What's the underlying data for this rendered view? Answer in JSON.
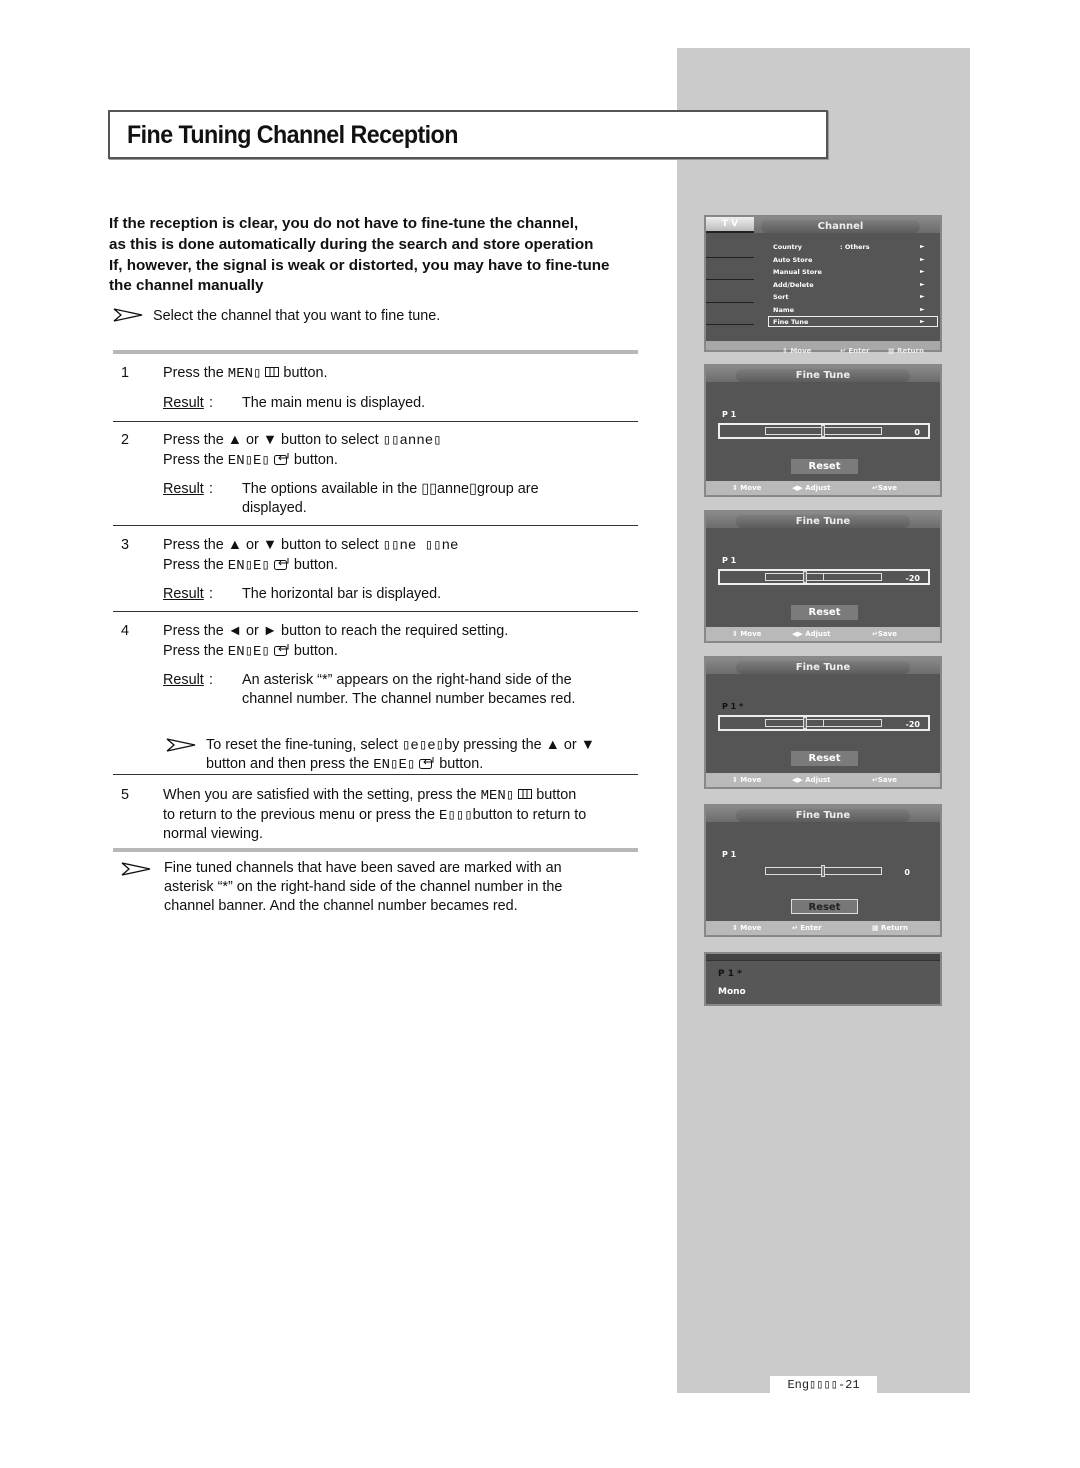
{
  "title": "Fine Tuning Channel Reception",
  "intro_lines": [
    "If the reception is clear, you do not have to fine-tune the channel,",
    "as this is done automatically during the search and store operation",
    "If, however, the signal is weak or distorted, you may have to fine-tune",
    "the channel manually"
  ],
  "intro_note": "Select the channel that you want to fine tune.",
  "result_label": "Result",
  "steps": [
    {
      "num": "1",
      "lines": [
        {
          "pre": "Press the ",
          "key": "MEN▯",
          "icon": "menu-icon",
          "post": " button."
        }
      ],
      "result": "The main menu is displayed."
    },
    {
      "num": "2",
      "lines": [
        {
          "pre": "Press the ▲ or ▼ button to select ",
          "key": "▯▯anne▯",
          "post": ""
        },
        {
          "pre": "Press the ",
          "key": "EN▯E▯",
          "icon": "enter-icon",
          "post": " button."
        }
      ],
      "result": "The options available in the ▯▯anne▯group are displayed."
    },
    {
      "num": "3",
      "lines": [
        {
          "pre": "Press the ▲ or ▼ button to select ",
          "key": "▯▯ne ▯▯ne",
          "post": ""
        },
        {
          "pre": "Press the ",
          "key": "EN▯E▯",
          "icon": "enter-icon",
          "post": " button."
        }
      ],
      "result": "The horizontal bar is displayed."
    },
    {
      "num": "4",
      "lines": [
        {
          "pre": "Press the ◄ or ► button to reach the required setting.",
          "key": "",
          "post": ""
        },
        {
          "pre": "Press the ",
          "key": "EN▯E▯",
          "icon": "enter-icon",
          "post": " button."
        }
      ],
      "result_lines": [
        "An asterisk  “*” appears on the right-hand side of the",
        "channel number. The channel number becames red."
      ],
      "note_lines": [
        {
          "pre": "To reset the fine-tuning, select ",
          "key": "▯e▯e▯",
          "post": "by pressing the ▲ or ▼"
        },
        {
          "pre": "button and then press the ",
          "key": "EN▯E▯",
          "icon": "enter-icon",
          "post": " button."
        }
      ]
    },
    {
      "num": "5",
      "lines": [
        {
          "pre": "When you are satisfied with the setting, press the ",
          "key": "MEN▯",
          "icon": "menu-icon",
          "post": " button"
        },
        {
          "pre": "to return to the previous menu or press the ",
          "key": "E▯▯▯",
          "post": "button to return to"
        },
        {
          "pre": "normal viewing.",
          "key": "",
          "post": ""
        }
      ]
    }
  ],
  "final_note_lines": [
    "Fine tuned channels that have been saved are marked with an",
    "asterisk “*” on the right-hand side of the channel number in the",
    "channel banner. And the channel number becames red."
  ],
  "tv_channel_menu": {
    "tab": "T V",
    "header": "Channel",
    "items": [
      {
        "label": "Country",
        "value": ":  Others"
      },
      {
        "label": "Auto Store",
        "value": ""
      },
      {
        "label": "Manual Store",
        "value": ""
      },
      {
        "label": "Add/Delete",
        "value": ""
      },
      {
        "label": "Sort",
        "value": ""
      },
      {
        "label": "Name",
        "value": ""
      },
      {
        "label": "Fine Tune",
        "value": ""
      }
    ],
    "selected_index": 6,
    "footer": {
      "move": "Move",
      "enter": "Enter",
      "return": "Return"
    }
  },
  "fine_tune_screens": [
    {
      "header": "Fine Tune",
      "channel": "P  1",
      "value_label": "0",
      "value": 0,
      "adjusted": false,
      "reset": "Reset",
      "reset_selected": false,
      "footer": {
        "move": "Move",
        "mid": "Adjust",
        "right": "Save"
      }
    },
    {
      "header": "Fine Tune",
      "channel": "P  1",
      "value_label": "-20",
      "value": -20,
      "adjusted": false,
      "reset": "Reset",
      "reset_selected": false,
      "footer": {
        "move": "Move",
        "mid": "Adjust",
        "right": "Save"
      }
    },
    {
      "header": "Fine Tune",
      "channel": "P  1  *",
      "value_label": "-20",
      "value": -20,
      "adjusted": true,
      "reset": "Reset",
      "reset_selected": false,
      "footer": {
        "move": "Move",
        "mid": "Adjust",
        "right": "Save"
      }
    },
    {
      "header": "Fine Tune",
      "channel": "P  1",
      "value_label": "0",
      "value": 0,
      "adjusted": false,
      "reset": "Reset",
      "reset_selected": true,
      "footer": {
        "move": "Move",
        "mid": "Enter",
        "right": "Return"
      }
    }
  ],
  "fine_tune_range": [
    -64,
    64
  ],
  "channel_banner": {
    "channel": "P  1  *",
    "sound": "Mono"
  },
  "page_number": "Eng▯▯▯▯-21",
  "colors": {
    "adjusted_channel": "#111111",
    "panel_bg": "#555555",
    "side_column": "#cbcbcb"
  }
}
